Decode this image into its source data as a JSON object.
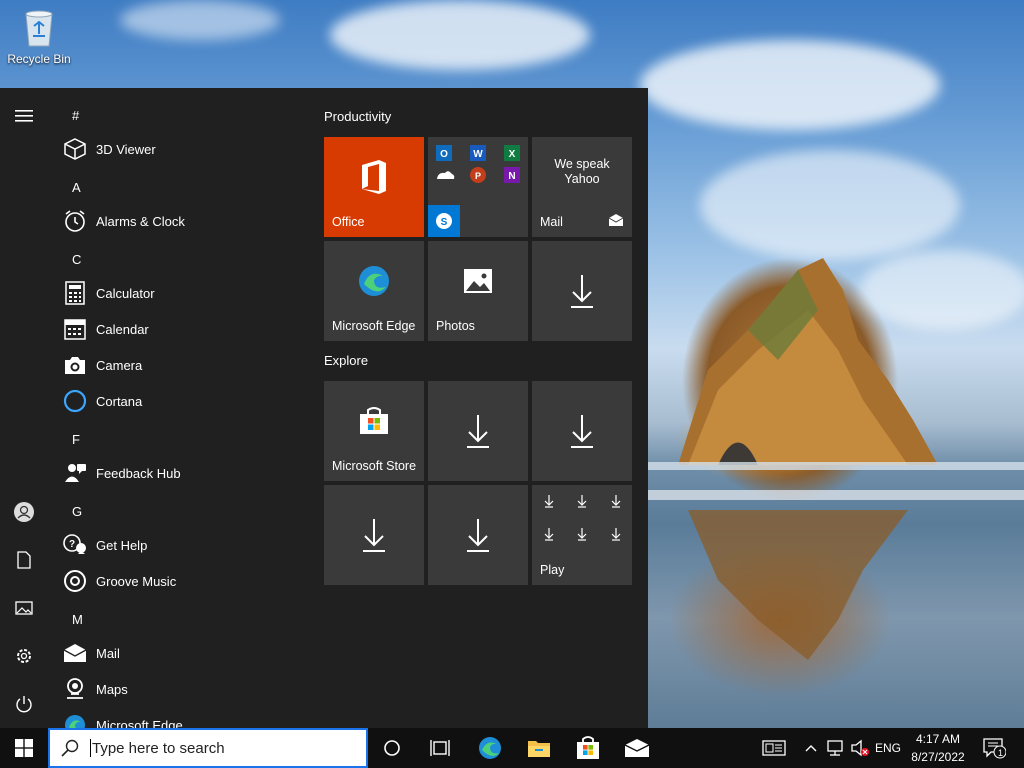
{
  "desktop": {
    "icons": [
      {
        "label": "Recycle Bin",
        "icon": "recycle-bin-icon"
      }
    ]
  },
  "start_menu": {
    "rail": [
      "hamburger-menu-icon",
      "user-icon",
      "documents-icon",
      "pictures-icon",
      "settings-icon",
      "power-icon"
    ],
    "app_list": {
      "groups": [
        {
          "letter": "#",
          "apps": [
            {
              "label": "3D Viewer",
              "icon": "3d-viewer-icon"
            }
          ]
        },
        {
          "letter": "A",
          "apps": [
            {
              "label": "Alarms & Clock",
              "icon": "alarm-clock-icon"
            }
          ]
        },
        {
          "letter": "C",
          "apps": [
            {
              "label": "Calculator",
              "icon": "calculator-icon"
            },
            {
              "label": "Calendar",
              "icon": "calendar-icon"
            },
            {
              "label": "Camera",
              "icon": "camera-icon"
            },
            {
              "label": "Cortana",
              "icon": "cortana-icon"
            }
          ]
        },
        {
          "letter": "F",
          "apps": [
            {
              "label": "Feedback Hub",
              "icon": "feedback-hub-icon"
            }
          ]
        },
        {
          "letter": "G",
          "apps": [
            {
              "label": "Get Help",
              "icon": "get-help-icon"
            },
            {
              "label": "Groove Music",
              "icon": "groove-music-icon"
            }
          ]
        },
        {
          "letter": "M",
          "apps": [
            {
              "label": "Mail",
              "icon": "mail-icon"
            },
            {
              "label": "Maps",
              "icon": "maps-icon"
            },
            {
              "label": "Microsoft Edge",
              "icon": "edge-icon"
            }
          ]
        }
      ]
    },
    "tiles": {
      "productivity": {
        "title": "Productivity",
        "office_label": "Office",
        "mail_text": "We speak Yahoo",
        "mail_label": "Mail",
        "edge_label": "Microsoft Edge",
        "photos_label": "Photos"
      },
      "explore": {
        "title": "Explore",
        "store_label": "Microsoft Store",
        "play_label": "Play"
      }
    }
  },
  "taskbar": {
    "search_placeholder": "Type here to search",
    "language": "ENG",
    "time": "4:17 AM",
    "date": "8/27/2022",
    "notification_count": "1"
  },
  "colors": {
    "office_tile": "#d83b01",
    "start_bg": "#202020",
    "tile_bg": "#3a3a3a",
    "taskbar_bg": "#101010"
  }
}
